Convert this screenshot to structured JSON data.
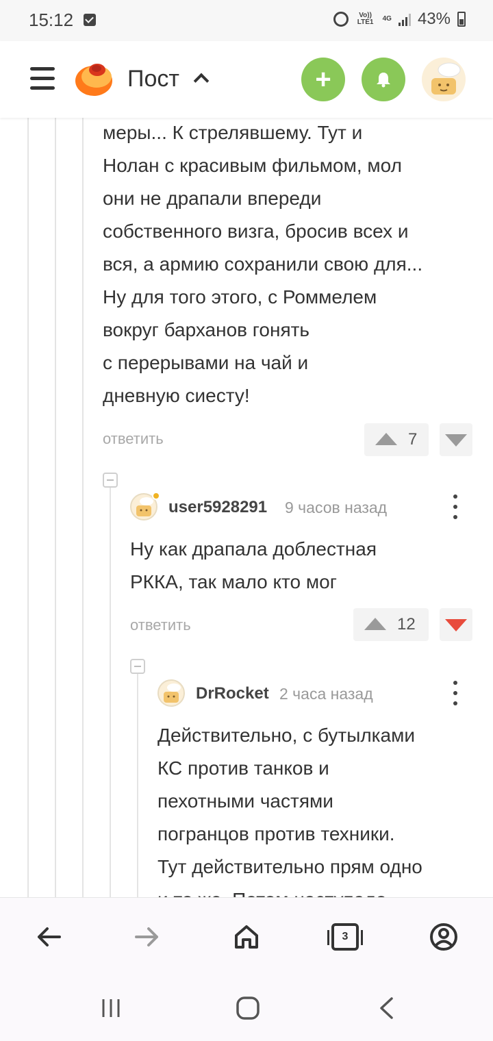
{
  "status_bar": {
    "time": "15:12",
    "lte_label": "Vo)) LTE1",
    "net_label": "4G",
    "battery": "43%"
  },
  "header": {
    "title": "Пост",
    "icons": [
      "menu-icon",
      "logo",
      "plus-icon",
      "bell-icon",
      "avatar"
    ],
    "accent_color": "#8ac858"
  },
  "comments": [
    {
      "text": "меры... К стрелявшему. Тут и\nНолан с красивым фильмом, мол\nони не драпали впереди\nсобственного визга, бросив всех и\nвся, а армию сохранили свою для...\nНу для того этого, с Роммелем\nвокруг барханов гонять\nс перерывами на чай и\nдневную сиесту!",
      "reply_label": "ответить",
      "rating": "7",
      "downvoted": false
    },
    {
      "user": "user5928291",
      "time": "9 часов назад",
      "text": "Ну как драпала доблестная\nРККА, так мало кто мог",
      "reply_label": "ответить",
      "rating": "12",
      "downvoted": true
    },
    {
      "user": "DrRocket",
      "time": "2 часа назад",
      "text": "Действительно, с бутылками\nКС против танков и\nпехотными частями\nпогранцов против техники.\nТут действительно прям одно\nи то же. Потом наступало"
    }
  ],
  "browser_bar": {
    "tab_count": "3",
    "icons": [
      "back-arrow-icon",
      "forward-arrow-icon",
      "home-icon",
      "tabs-icon",
      "account-icon"
    ]
  },
  "system_nav": {
    "icons": [
      "recents-icon",
      "home-circle-icon",
      "back-icon"
    ]
  },
  "colors": {
    "downvote_active": "#e84c3d",
    "muted_text": "#a8a8a8"
  }
}
